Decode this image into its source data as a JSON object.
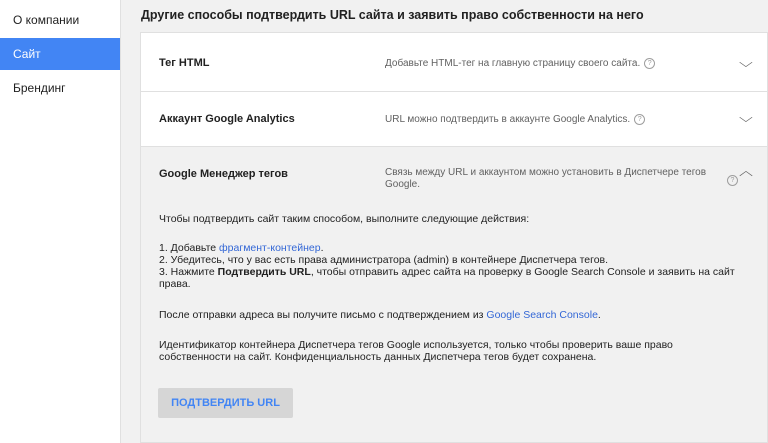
{
  "sidebar": {
    "items": [
      {
        "label": "О компании"
      },
      {
        "label": "Сайт"
      },
      {
        "label": "Брендинг"
      }
    ]
  },
  "section_title": "Другие способы подтвердить URL сайта и заявить право собственности на него",
  "methods": [
    {
      "title": "Тег HTML",
      "description": "Добавьте HTML-тег на главную страницу своего сайта."
    },
    {
      "title": "Аккаунт Google Analytics",
      "description": "URL можно подтвердить в аккаунте Google Analytics."
    },
    {
      "title": "Google Менеджер тегов",
      "description": "Связь между URL и аккаунтом можно установить в Диспетчере тегов Google.",
      "intro": "Чтобы подтвердить сайт таким способом, выполните следующие действия:",
      "step1_prefix": "1. Добавьте ",
      "step1_link": "фрагмент-контейнер",
      "step1_suffix": ".",
      "step2": "2. Убедитесь, что у вас есть права администратора (admin) в контейнере Диспетчера тегов.",
      "step3_prefix": "3. Нажмите ",
      "step3_bold": "Подтвердить URL",
      "step3_suffix": ", чтобы отправить адрес сайта на проверку в Google Search Console и заявить на сайт права.",
      "after_prefix": "После отправки адреса вы получите письмо с подтверждением из ",
      "after_link": "Google Search Console",
      "after_suffix": ".",
      "note": "Идентификатор контейнера Диспетчера тегов Google используется, только чтобы проверить ваше право собственности на сайт. Конфиденциальность данных Диспетчера тегов будет сохранена.",
      "button_label": "ПОДТВЕРДИТЬ URL"
    }
  ],
  "help_glyph": "?",
  "icons": {
    "help": "help-circle-icon",
    "expand": "chevron-down-icon",
    "collapse": "chevron-up-icon"
  },
  "colors": {
    "accent": "#4285f4",
    "link": "#3367d6",
    "background": "#f1f1f1"
  }
}
